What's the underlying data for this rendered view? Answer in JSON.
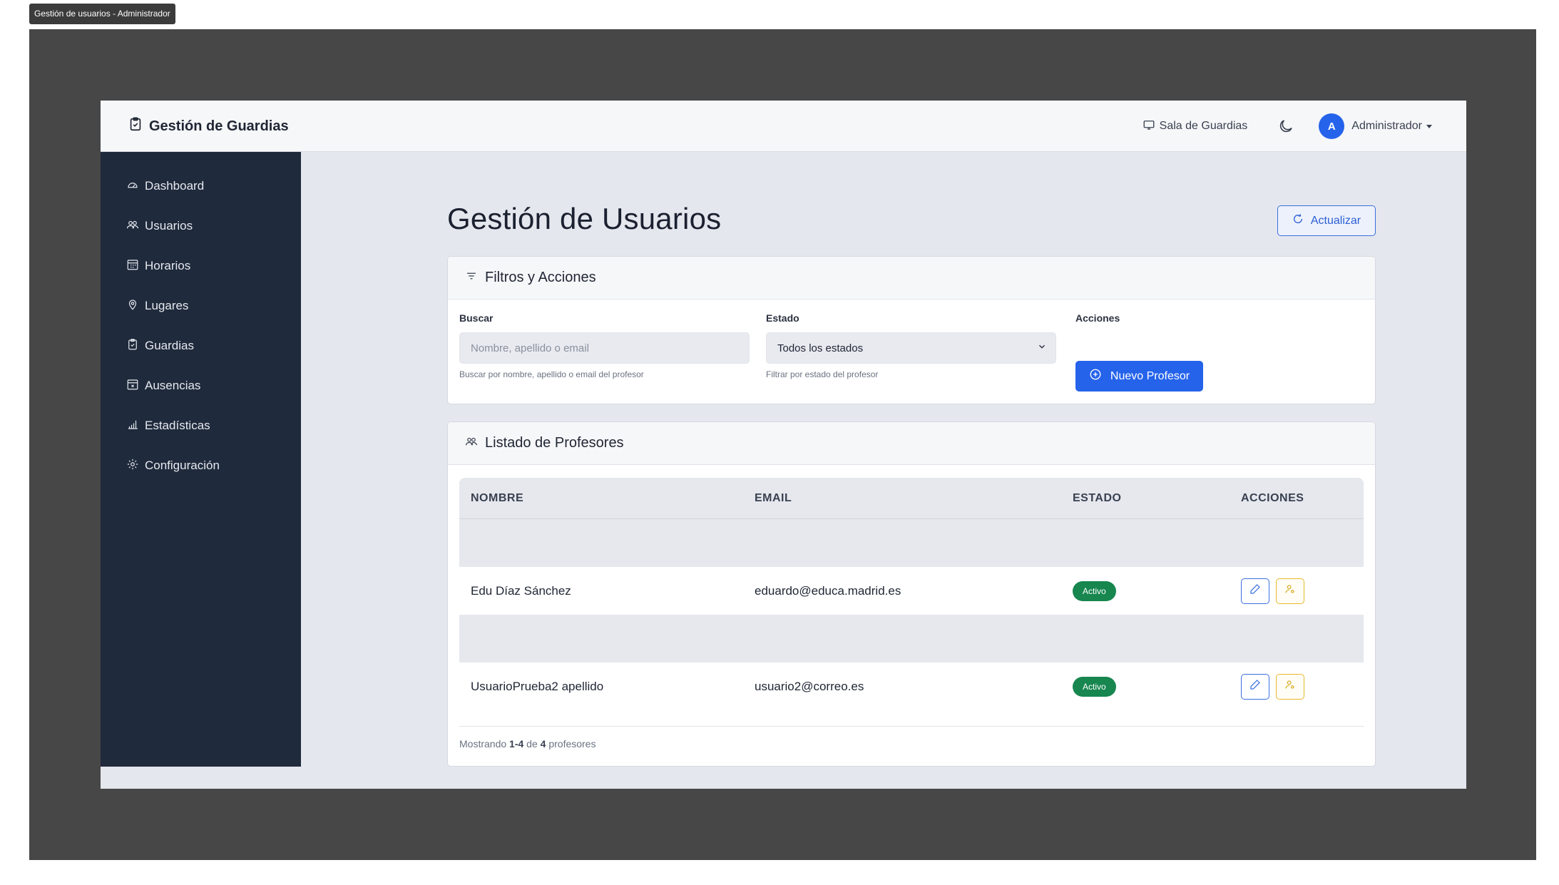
{
  "window": {
    "title": "Gestión de usuarios - Administrador"
  },
  "topbar": {
    "brand": "Gestión de Guardias",
    "sala_label": "Sala de Guardias",
    "avatar_letter": "A",
    "user_name": "Administrador"
  },
  "sidebar": {
    "items": [
      {
        "label": "Dashboard",
        "icon": "speedometer-icon"
      },
      {
        "label": "Usuarios",
        "icon": "people-icon"
      },
      {
        "label": "Horarios",
        "icon": "calendar-grid-icon"
      },
      {
        "label": "Lugares",
        "icon": "location-pin-icon"
      },
      {
        "label": "Guardias",
        "icon": "clipboard-icon"
      },
      {
        "label": "Ausencias",
        "icon": "calendar-x-icon"
      },
      {
        "label": "Estadísticas",
        "icon": "bar-chart-icon"
      },
      {
        "label": "Configuración",
        "icon": "gear-icon"
      }
    ]
  },
  "main": {
    "title": "Gestión de Usuarios",
    "refresh_label": "Actualizar"
  },
  "filters": {
    "title": "Filtros y Acciones",
    "search_label": "Buscar",
    "search_placeholder": "Nombre, apellido o email",
    "search_value": "",
    "search_hint": "Buscar por nombre, apellido o email del profesor",
    "state_label": "Estado",
    "state_value": "Todos los estados",
    "state_hint": "Filtrar por estado del profesor",
    "actions_label": "Acciones",
    "new_button": "Nuevo Profesor"
  },
  "list": {
    "title": "Listado de Profesores",
    "columns": [
      "NOMBRE",
      "EMAIL",
      "ESTADO",
      "ACCIONES"
    ],
    "rows": [
      {
        "name": "",
        "email": "",
        "state": ""
      },
      {
        "name": "Edu Díaz Sánchez",
        "email": "eduardo@educa.madrid.es",
        "state": "Activo"
      },
      {
        "name": "",
        "email": "",
        "state": ""
      },
      {
        "name": "UsuarioPrueba2 apellido",
        "email": "usuario2@correo.es",
        "state": "Activo"
      }
    ],
    "footer": {
      "prefix": "Mostrando",
      "range": "1-4",
      "middle": "de",
      "total": "4",
      "suffix": "profesores"
    }
  },
  "colors": {
    "primary": "#2563eb",
    "sidebar": "#1f2a3c",
    "success": "#17864f",
    "warning": "#e7b92a"
  }
}
